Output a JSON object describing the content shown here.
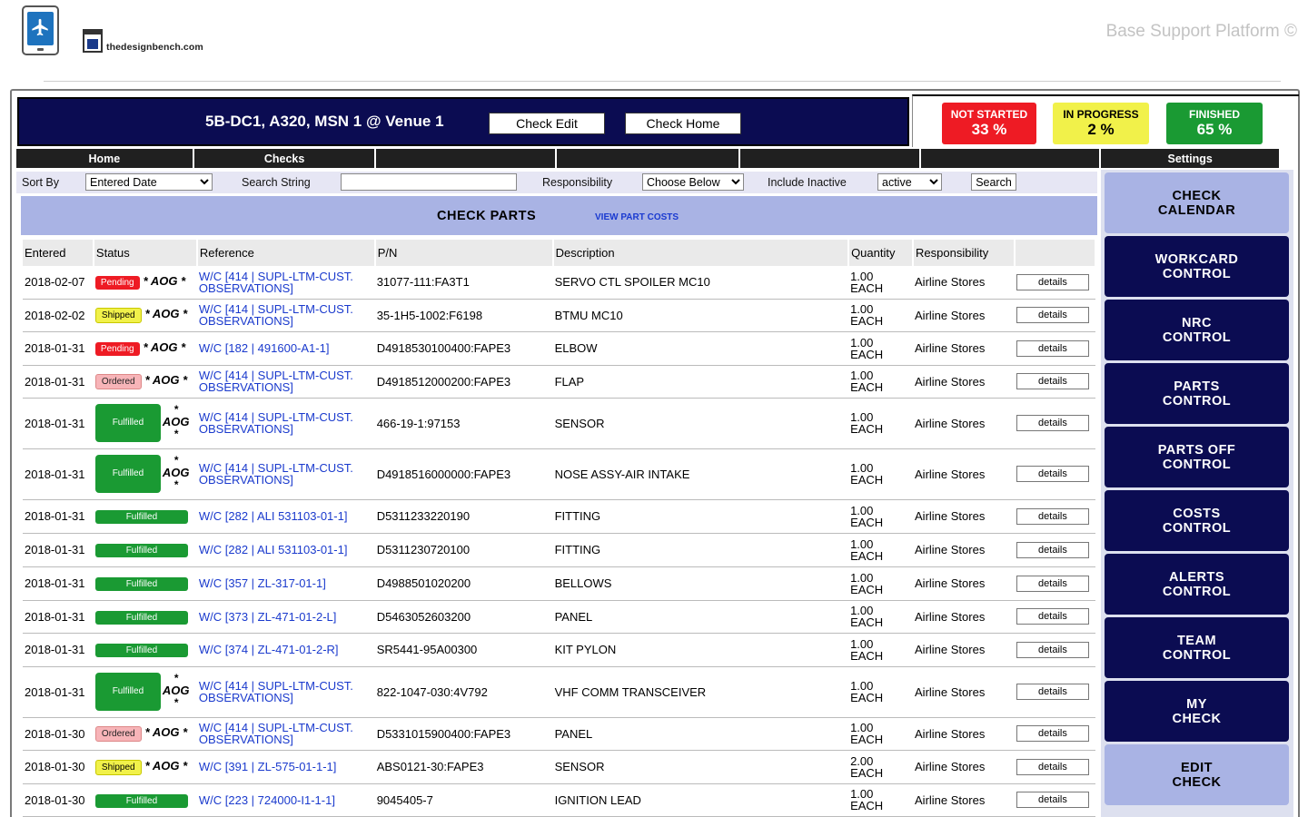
{
  "header": {
    "logo_text": "thedesignbench.com",
    "brand": "Base Support Platform ©"
  },
  "banner": {
    "title": "5B-DC1, A320, MSN 1 @ Venue 1",
    "check_edit": "Check Edit",
    "check_home": "Check Home"
  },
  "stats": {
    "not_started_label": "NOT STARTED",
    "not_started_value": "33 %",
    "in_progress_label": "IN PROGRESS",
    "in_progress_value": "2 %",
    "finished_label": "FINISHED",
    "finished_value": "65 %"
  },
  "nav": {
    "home": "Home",
    "checks": "Checks",
    "blank1": "",
    "blank2": "",
    "blank3": "",
    "blank4": "",
    "settings": "Settings"
  },
  "filter": {
    "sort_by_label": "Sort By",
    "sort_by_value": "Entered Date",
    "search_string_label": "Search String",
    "search_value": "",
    "responsibility_label": "Responsibility",
    "responsibility_value": "Choose Below",
    "include_inactive_label": "Include Inactive",
    "include_inactive_value": "active",
    "search_button": "Search"
  },
  "check_parts": {
    "title": "CHECK PARTS",
    "link": "VIEW PART COSTS"
  },
  "table": {
    "headers": {
      "entered": "Entered",
      "status": "Status",
      "reference": "Reference",
      "pn": "P/N",
      "description": "Description",
      "quantity": "Quantity",
      "responsibility": "Responsibility"
    },
    "details_label": "details",
    "aog_label": "AOG",
    "star": "*",
    "rows": [
      {
        "entered": "2018-02-07",
        "status": "Pending",
        "aog": true,
        "ref1": "W/C [414 | SUPL-LTM-CUST.",
        "ref2": "OBSERVATIONS]",
        "pn": "31077-111:FA3T1",
        "desc": "SERVO CTL SPOILER MC10",
        "qty": "1.00",
        "unit": "EACH",
        "resp": "Airline Stores"
      },
      {
        "entered": "2018-02-02",
        "status": "Shipped",
        "aog": true,
        "ref1": "W/C [414 | SUPL-LTM-CUST.",
        "ref2": "OBSERVATIONS]",
        "pn": "35-1H5-1002:F6198",
        "desc": "BTMU MC10",
        "qty": "1.00",
        "unit": "EACH",
        "resp": "Airline Stores"
      },
      {
        "entered": "2018-01-31",
        "status": "Pending",
        "aog": true,
        "ref1": "W/C [182 | 491600-A1-1]",
        "ref2": "",
        "pn": "D4918530100400:FAPE3",
        "desc": "ELBOW",
        "qty": "1.00",
        "unit": "EACH",
        "resp": "Airline Stores"
      },
      {
        "entered": "2018-01-31",
        "status": "Ordered",
        "aog": true,
        "ref1": "W/C [414 | SUPL-LTM-CUST.",
        "ref2": "OBSERVATIONS]",
        "pn": "D4918512000200:FAPE3",
        "desc": "FLAP",
        "qty": "1.00",
        "unit": "EACH",
        "resp": "Airline Stores"
      },
      {
        "entered": "2018-01-31",
        "status": "Fulfilled",
        "aog": true,
        "tall": true,
        "ref1": "W/C [414 | SUPL-LTM-CUST.",
        "ref2": "OBSERVATIONS]",
        "pn": "466-19-1:97153",
        "desc": "SENSOR",
        "qty": "1.00",
        "unit": "EACH",
        "resp": "Airline Stores"
      },
      {
        "entered": "2018-01-31",
        "status": "Fulfilled",
        "aog": true,
        "tall": true,
        "ref1": "W/C [414 | SUPL-LTM-CUST.",
        "ref2": "OBSERVATIONS]",
        "pn": "D4918516000000:FAPE3",
        "desc": "NOSE ASSY-AIR INTAKE",
        "qty": "1.00",
        "unit": "EACH",
        "resp": "Airline Stores"
      },
      {
        "entered": "2018-01-31",
        "status": "Fulfilled",
        "aog": false,
        "ref1": "W/C [282 | ALI 531103-01-1]",
        "ref2": "",
        "pn": "D5311233220190",
        "desc": "FITTING",
        "qty": "1.00",
        "unit": "EACH",
        "resp": "Airline Stores"
      },
      {
        "entered": "2018-01-31",
        "status": "Fulfilled",
        "aog": false,
        "ref1": "W/C [282 | ALI 531103-01-1]",
        "ref2": "",
        "pn": "D5311230720100",
        "desc": "FITTING",
        "qty": "1.00",
        "unit": "EACH",
        "resp": "Airline Stores"
      },
      {
        "entered": "2018-01-31",
        "status": "Fulfilled",
        "aog": false,
        "ref1": "W/C [357 | ZL-317-01-1]",
        "ref2": "",
        "pn": "D4988501020200",
        "desc": "BELLOWS",
        "qty": "1.00",
        "unit": "EACH",
        "resp": "Airline Stores"
      },
      {
        "entered": "2018-01-31",
        "status": "Fulfilled",
        "aog": false,
        "ref1": "W/C [373 | ZL-471-01-2-L]",
        "ref2": "",
        "pn": "D5463052603200",
        "desc": "PANEL",
        "qty": "1.00",
        "unit": "EACH",
        "resp": "Airline Stores"
      },
      {
        "entered": "2018-01-31",
        "status": "Fulfilled",
        "aog": false,
        "ref1": "W/C [374 | ZL-471-01-2-R]",
        "ref2": "",
        "pn": "SR5441-95A00300",
        "desc": "KIT PYLON",
        "qty": "1.00",
        "unit": "EACH",
        "resp": "Airline Stores"
      },
      {
        "entered": "2018-01-31",
        "status": "Fulfilled",
        "aog": true,
        "tall": true,
        "ref1": "W/C [414 | SUPL-LTM-CUST.",
        "ref2": "OBSERVATIONS]",
        "pn": "822-1047-030:4V792",
        "desc": "VHF COMM TRANSCEIVER",
        "qty": "1.00",
        "unit": "EACH",
        "resp": "Airline Stores"
      },
      {
        "entered": "2018-01-30",
        "status": "Ordered",
        "aog": true,
        "ref1": "W/C [414 | SUPL-LTM-CUST.",
        "ref2": "OBSERVATIONS]",
        "pn": "D5331015900400:FAPE3",
        "desc": "PANEL",
        "qty": "1.00",
        "unit": "EACH",
        "resp": "Airline Stores"
      },
      {
        "entered": "2018-01-30",
        "status": "Shipped",
        "aog": true,
        "ref1": "W/C [391 | ZL-575-01-1-1]",
        "ref2": "",
        "pn": "ABS0121-30:FAPE3",
        "desc": "SENSOR",
        "qty": "2.00",
        "unit": "EACH",
        "resp": "Airline Stores"
      },
      {
        "entered": "2018-01-30",
        "status": "Fulfilled",
        "aog": false,
        "ref1": "W/C [223 | 724000-I1-1-1]",
        "ref2": "",
        "pn": "9045405-7",
        "desc": "IGNITION LEAD",
        "qty": "1.00",
        "unit": "EACH",
        "resp": "Airline Stores"
      }
    ]
  },
  "side_menu": [
    {
      "label1": "CHECK",
      "label2": "CALENDAR",
      "light": true
    },
    {
      "label1": "WORKCARD",
      "label2": "CONTROL",
      "light": false
    },
    {
      "label1": "NRC",
      "label2": "CONTROL",
      "light": false
    },
    {
      "label1": "PARTS",
      "label2": "CONTROL",
      "light": false
    },
    {
      "label1": "PARTS OFF",
      "label2": "CONTROL",
      "light": false
    },
    {
      "label1": "COSTS",
      "label2": "CONTROL",
      "light": false
    },
    {
      "label1": "ALERTS",
      "label2": "CONTROL",
      "light": false
    },
    {
      "label1": "TEAM",
      "label2": "CONTROL",
      "light": false
    },
    {
      "label1": "MY",
      "label2": "CHECK",
      "light": false
    },
    {
      "label1": "EDIT",
      "label2": "CHECK",
      "light": true
    }
  ]
}
